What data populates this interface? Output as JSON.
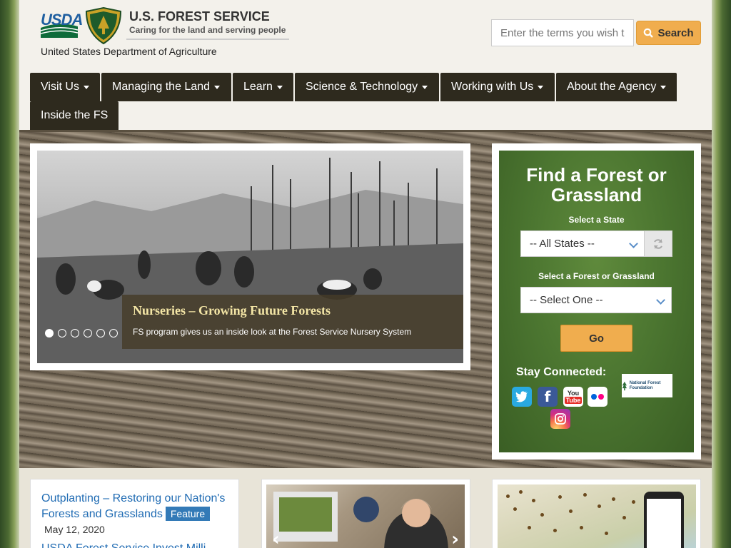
{
  "header": {
    "usda_text": "USDA",
    "agency_name": "U.S. FOREST SERVICE",
    "tagline": "Caring for the land and serving people",
    "department": "United States Department of Agriculture",
    "search_placeholder": "Enter the terms you wish t",
    "search_label": "Search"
  },
  "nav": {
    "items": [
      {
        "label": "Visit Us"
      },
      {
        "label": "Managing the Land"
      },
      {
        "label": "Learn"
      },
      {
        "label": "Science & Technology"
      },
      {
        "label": "Working with Us"
      },
      {
        "label": "About the Agency"
      },
      {
        "label": "Inside the FS"
      }
    ]
  },
  "carousel": {
    "title": "Nurseries – Growing Future Forests",
    "text": "FS program gives us an inside look at the Forest Service Nursery System",
    "slide_count": 6,
    "active_slide": 1
  },
  "finder": {
    "title": "Find a Forest or Grassland",
    "state_label": "Select a State",
    "state_value": "-- All States --",
    "forest_label": "Select a Forest or Grassland",
    "forest_value": "-- Select One --",
    "go_label": "Go",
    "stay_connected": "Stay Connected:",
    "nff_text": "National Forest Foundation"
  },
  "news": {
    "headline": "Outplanting – Restoring our Nation's Forests and Grasslands",
    "badge": "Feature",
    "date": "May 12, 2020",
    "headline_2": "USDA Forest Service Invest Milli..."
  },
  "colors": {
    "nav_bg": "#2e2a1e",
    "accent_button": "#f0ad4e",
    "finder_green": "#4b7530",
    "link_blue": "#1f6bb3",
    "badge_blue": "#337ab7"
  }
}
